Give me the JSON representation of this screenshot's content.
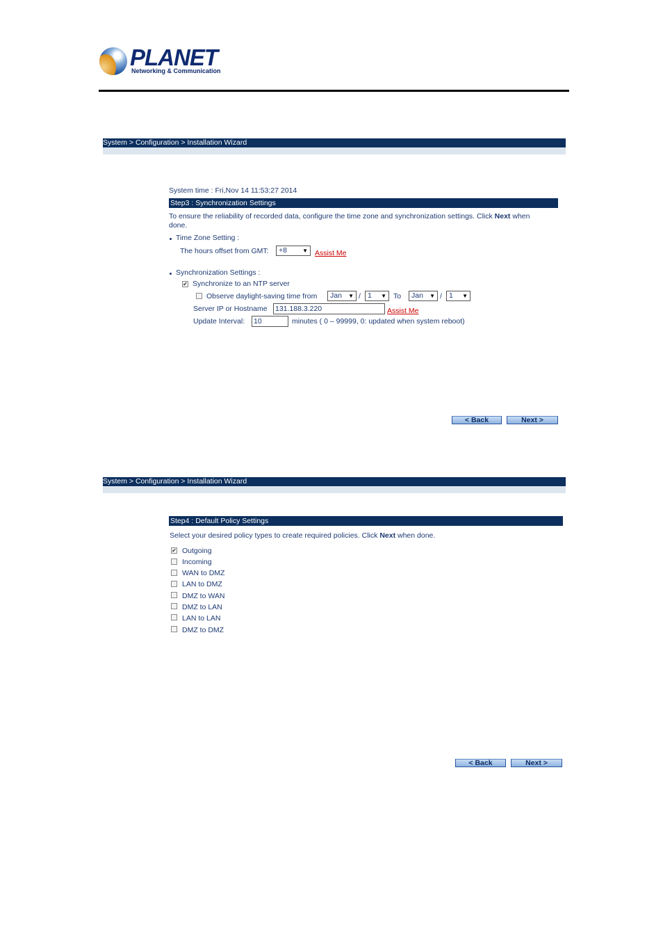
{
  "brand": {
    "name": "PLANET",
    "tagline": "Networking & Communication"
  },
  "panel1": {
    "breadcrumb": "System > Configuration > Installation Wizard",
    "system_time": "System time : Fri,Nov 14 11:53:27 2014",
    "step_title": "Step3 : Synchronization Settings",
    "intro_prefix": "To ensure the reliability of recorded data, configure the time zone and synchronization settings. Click ",
    "intro_next": "Next",
    "intro_suffix": " when",
    "intro_line2": "done.",
    "tz_heading": "Time Zone Setting :",
    "gmt_label": "The hours offset from GMT:",
    "gmt_value": "+8",
    "assist_me": "Assist Me",
    "sync_heading": "Synchronization Settings :",
    "ntp_label": "Synchronize to an NTP server",
    "ntp_checked": true,
    "dst_label": "Observe daylight-saving time from",
    "dst_checked": false,
    "dst_from_month": "Jan",
    "dst_from_day": "1",
    "to_label": "To",
    "slash": "/",
    "dst_to_month": "Jan",
    "dst_to_day": "1",
    "server_label": "Server IP or Hostname",
    "server_value": "131.188.3.220",
    "interval_label": "Update Interval:",
    "interval_value": "10",
    "interval_hint": "minutes  ( 0 – 99999, 0: updated when system reboot)",
    "back_button": "< Back",
    "next_button": "Next >"
  },
  "panel2": {
    "breadcrumb": "System > Configuration > Installation Wizard",
    "step_title": "Step4 : Default Policy Settings",
    "intro_prefix": "Select your desired policy types to create required policies. Click ",
    "intro_next": "Next",
    "intro_suffix": " when done.",
    "policies": [
      {
        "label": "Outgoing",
        "checked": true
      },
      {
        "label": "Incoming",
        "checked": false
      },
      {
        "label": "WAN to DMZ",
        "checked": false
      },
      {
        "label": "LAN to DMZ",
        "checked": false
      },
      {
        "label": "DMZ to WAN",
        "checked": false
      },
      {
        "label": "DMZ to LAN",
        "checked": false
      },
      {
        "label": "LAN to LAN",
        "checked": false
      },
      {
        "label": "DMZ to DMZ",
        "checked": false
      }
    ],
    "back_button": "< Back",
    "next_button": "Next >"
  }
}
